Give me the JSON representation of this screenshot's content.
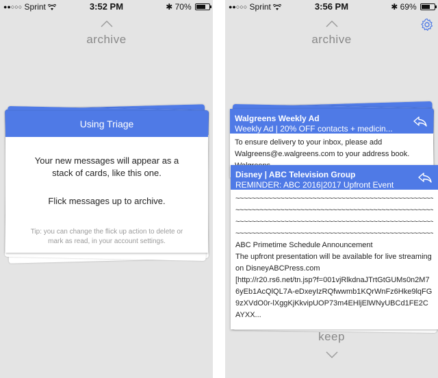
{
  "left": {
    "status": {
      "carrier": "Sprint",
      "time": "3:52 PM",
      "battery": "70%",
      "battery_fraction": 0.7
    },
    "archive_label": "archive",
    "card": {
      "title": "Using Triage",
      "message_1": "Your new messages will appear as a stack of cards, like this one.",
      "message_2": "Flick messages up to archive.",
      "tip": "Tip: you can change the flick up action to delete or mark as read, in your account settings."
    }
  },
  "right": {
    "status": {
      "carrier": "Sprint",
      "time": "3:56 PM",
      "battery": "69%",
      "battery_fraction": 0.69
    },
    "archive_label": "archive",
    "keep_label": "keep",
    "emails": [
      {
        "from": "Walgreens Weekly Ad",
        "subject": "Weekly Ad | 20% OFF contacts + medicin...",
        "body": "To ensure delivery to your inbox, please add Walgreens@e.walgreens.com to your address book. Walgreens"
      },
      {
        "from": "Disney | ABC Television Group",
        "subject": "REMINDER: ABC 2016|2017 Upfront Event",
        "tilde_lines": [
          "~~~~~~~~~~~~~~~~~~~~~~~~~~~~~~~~~~~~~~~~~~~~~~~~~~~~~~~~~~~~",
          "~~~~~~~~~~~~~~~~~~~~~~~~~~~~~~~~~~~~~~~~~~~~~~~~~~~~~~~~~~~~",
          "~~~~~~~~~~~~~~~~~~~~~~~~~~~~~~~~~~~~~~~~~~~~~~~~~~~~~~~~~~~~",
          "~~~~~~~~~~~~~~~~~~~~~~~~~~~~~~~~~~~~~~~~~~~~~~~~~~~~~~~~~~~~"
        ],
        "heading": "ABC Primetime Schedule Announcement",
        "body": "The upfront presentation will be available for live streaming on DisneyABCPress.com",
        "link": "[http://r20.rs6.net/tn.jsp?f=001vjRlkdnaJTrtGtGUMs0n2M76yEb1AcQlQL7A-eDxeyIzRQfwwmb1KQrWnFz6Hke9lqFG9zXVdO0r-lXggKjKkvipUOP73m4EHljElWNyUBCd1FE2CAYXX..."
      }
    ]
  },
  "icons": {
    "chevron_up": "chevron-up-icon",
    "chevron_down": "chevron-down-icon",
    "reply": "reply-icon",
    "gear": "gear-icon",
    "wifi": "wifi-icon",
    "bluetooth": "bluetooth-icon"
  },
  "colors": {
    "accent": "#4f7ae6",
    "background": "#e4e4e4",
    "muted_text": "#888888"
  }
}
